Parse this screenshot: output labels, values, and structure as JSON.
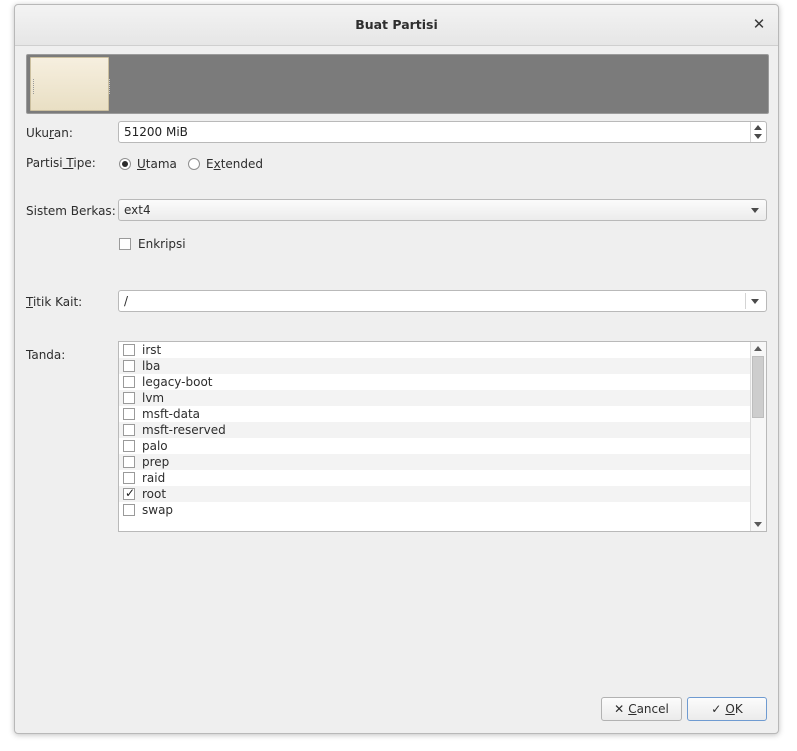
{
  "window": {
    "title": "Buat Partisi",
    "close_glyph": "✕"
  },
  "partition_bar": {
    "used_fraction": 0.106
  },
  "size": {
    "label_pre": "Uku",
    "label_ul": "r",
    "label_post": "an:",
    "value": "51200 MiB"
  },
  "partition_type": {
    "label_pre": "Partisi",
    "label_ul": " T",
    "label_post": "ipe:",
    "options": [
      {
        "pre": "",
        "ul": "U",
        "post": "tama",
        "selected": true
      },
      {
        "pre": "E",
        "ul": "x",
        "post": "tended",
        "selected": false
      }
    ]
  },
  "filesystem": {
    "label": "Sistem Berkas:",
    "value": "ext4"
  },
  "encryption": {
    "label": "Enkripsi",
    "checked": false
  },
  "mount_point": {
    "label_ul": "T",
    "label_post": "itik Kait:",
    "value": "/"
  },
  "flags": {
    "label": "Tanda:",
    "items": [
      {
        "name": "irst",
        "checked": false
      },
      {
        "name": "lba",
        "checked": false
      },
      {
        "name": "legacy-boot",
        "checked": false
      },
      {
        "name": "lvm",
        "checked": false
      },
      {
        "name": "msft-data",
        "checked": false
      },
      {
        "name": "msft-reserved",
        "checked": false
      },
      {
        "name": "palo",
        "checked": false
      },
      {
        "name": "prep",
        "checked": false
      },
      {
        "name": "raid",
        "checked": false
      },
      {
        "name": "root",
        "checked": true
      },
      {
        "name": "swap",
        "checked": false
      }
    ]
  },
  "buttons": {
    "cancel": {
      "icon": "✕",
      "pre": "",
      "ul": "C",
      "post": "ancel"
    },
    "ok": {
      "icon": "✓",
      "pre": "",
      "ul": "O",
      "post": "K"
    }
  },
  "check_glyph": "✓"
}
